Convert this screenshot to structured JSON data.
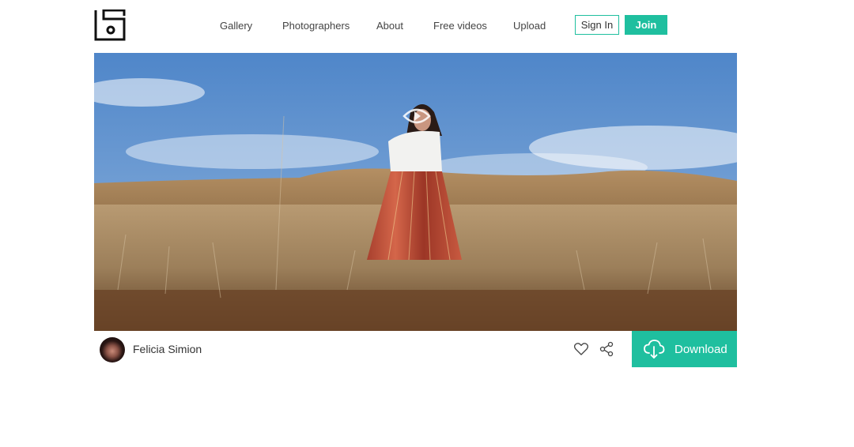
{
  "nav": {
    "items": [
      {
        "label": "Gallery"
      },
      {
        "label": "Photographers"
      },
      {
        "label": "About"
      },
      {
        "label": "Free videos"
      },
      {
        "label": "Upload"
      }
    ],
    "signin_label": "Sign In",
    "join_label": "Join"
  },
  "photo": {
    "play_icon": "play-icon"
  },
  "author": {
    "name": "Felicia Simion"
  },
  "actions": {
    "like_icon": "heart-icon",
    "share_icon": "share-icon",
    "download_icon": "cloud-download-icon",
    "download_label": "Download"
  },
  "colors": {
    "accent": "#1fbf9f",
    "text": "#333333"
  }
}
